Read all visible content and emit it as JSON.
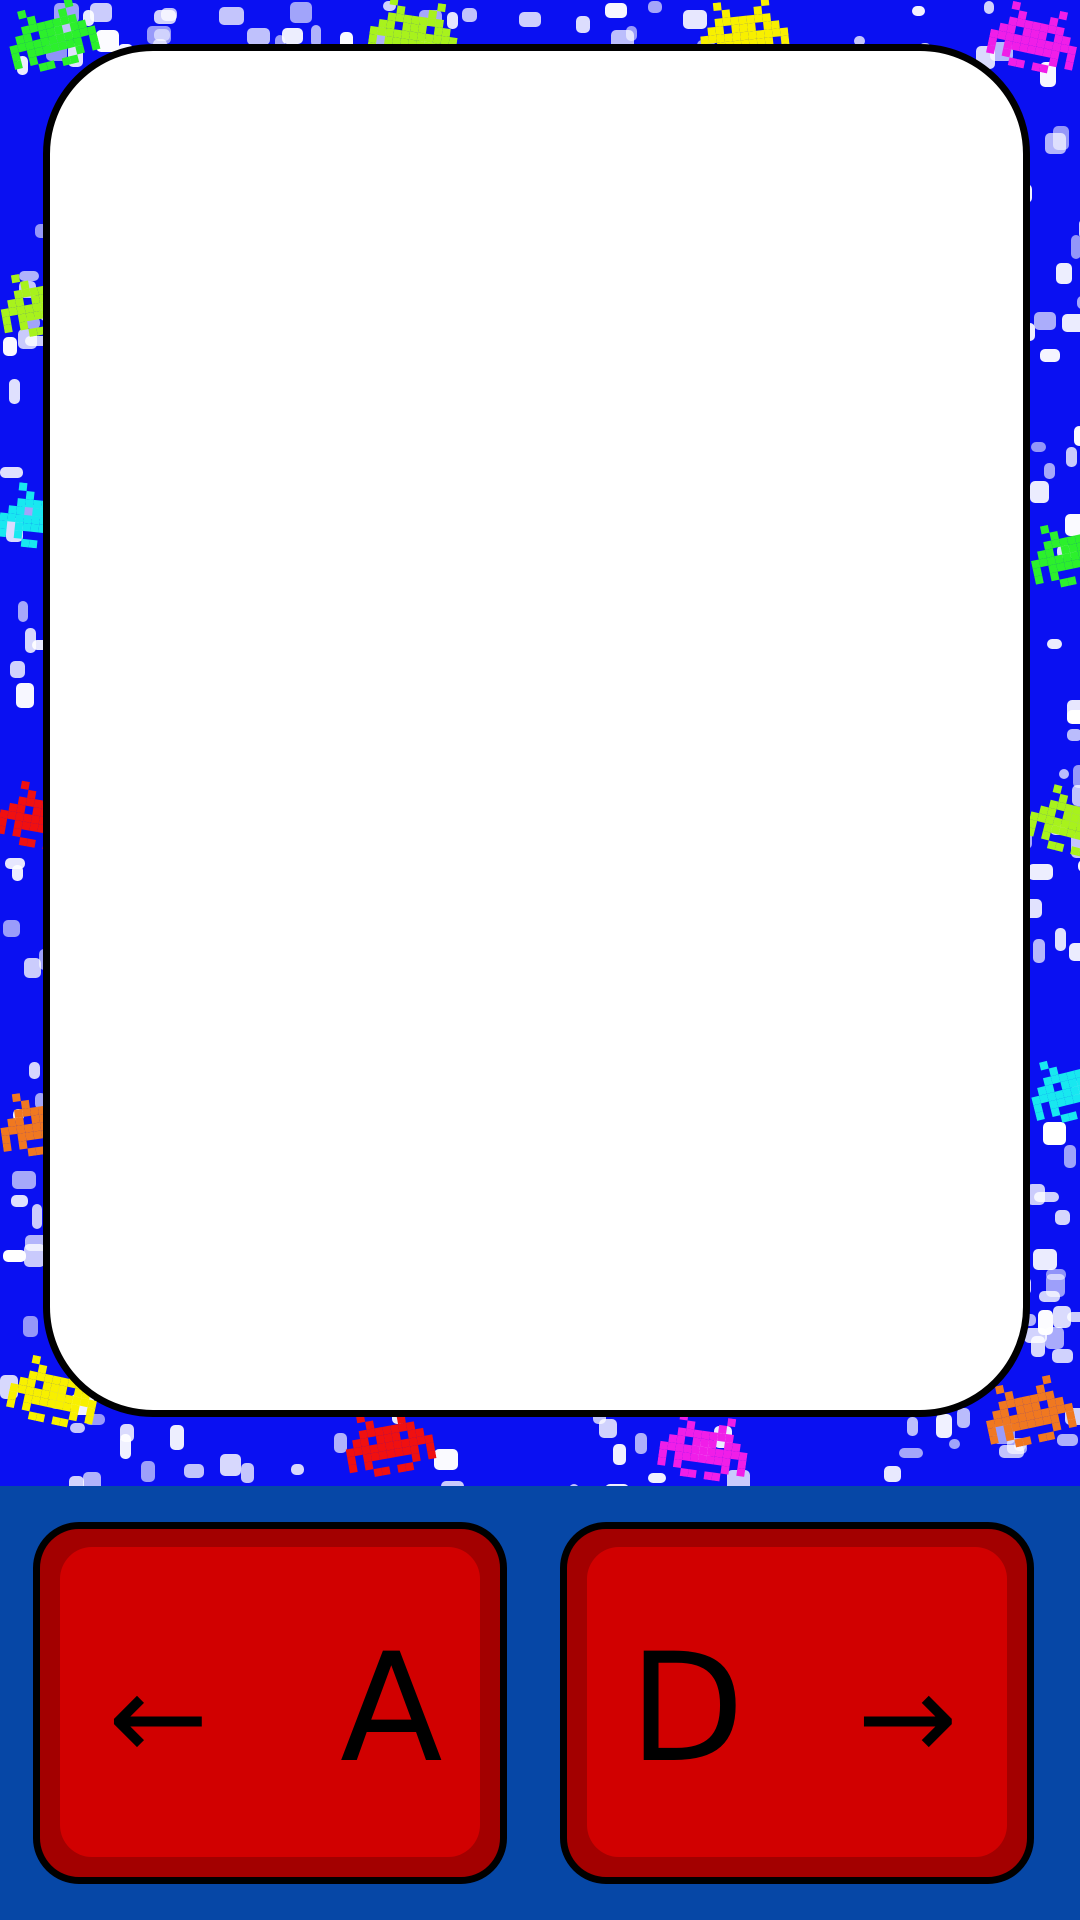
{
  "colors": {
    "playfield_background": "#0a10f2",
    "controls_background": "#0647a6",
    "key_fill": "#d10000",
    "key_rim": "#a30000",
    "card_fill": "#ffffff",
    "outline": "#000000"
  },
  "controls": {
    "left": {
      "arrow": "←",
      "letter": "A",
      "icon": "arrow-left-icon"
    },
    "right": {
      "letter": "D",
      "arrow": "→",
      "icon": "arrow-right-icon"
    }
  },
  "sprites": [
    {
      "name": "space-invader-icon",
      "color": "#2cf02c"
    },
    {
      "name": "space-invader-icon",
      "color": "#a8f21c"
    },
    {
      "name": "space-invader-icon",
      "color": "#f8f000"
    },
    {
      "name": "space-invader-icon",
      "color": "#f01ee8"
    },
    {
      "name": "space-invader-icon",
      "color": "#a8f21c"
    },
    {
      "name": "space-invader-icon",
      "color": "#18e8f0"
    },
    {
      "name": "space-invader-icon",
      "color": "#2cf02c"
    },
    {
      "name": "space-invader-icon",
      "color": "#f01010"
    },
    {
      "name": "space-invader-icon",
      "color": "#a8f21c"
    },
    {
      "name": "space-invader-icon",
      "color": "#f07820"
    },
    {
      "name": "space-invader-icon",
      "color": "#18e8f0"
    },
    {
      "name": "space-invader-icon",
      "color": "#f8f000"
    },
    {
      "name": "space-invader-icon",
      "color": "#f01010"
    },
    {
      "name": "space-invader-icon",
      "color": "#f01ee8"
    },
    {
      "name": "space-invader-icon",
      "color": "#f07820"
    }
  ]
}
